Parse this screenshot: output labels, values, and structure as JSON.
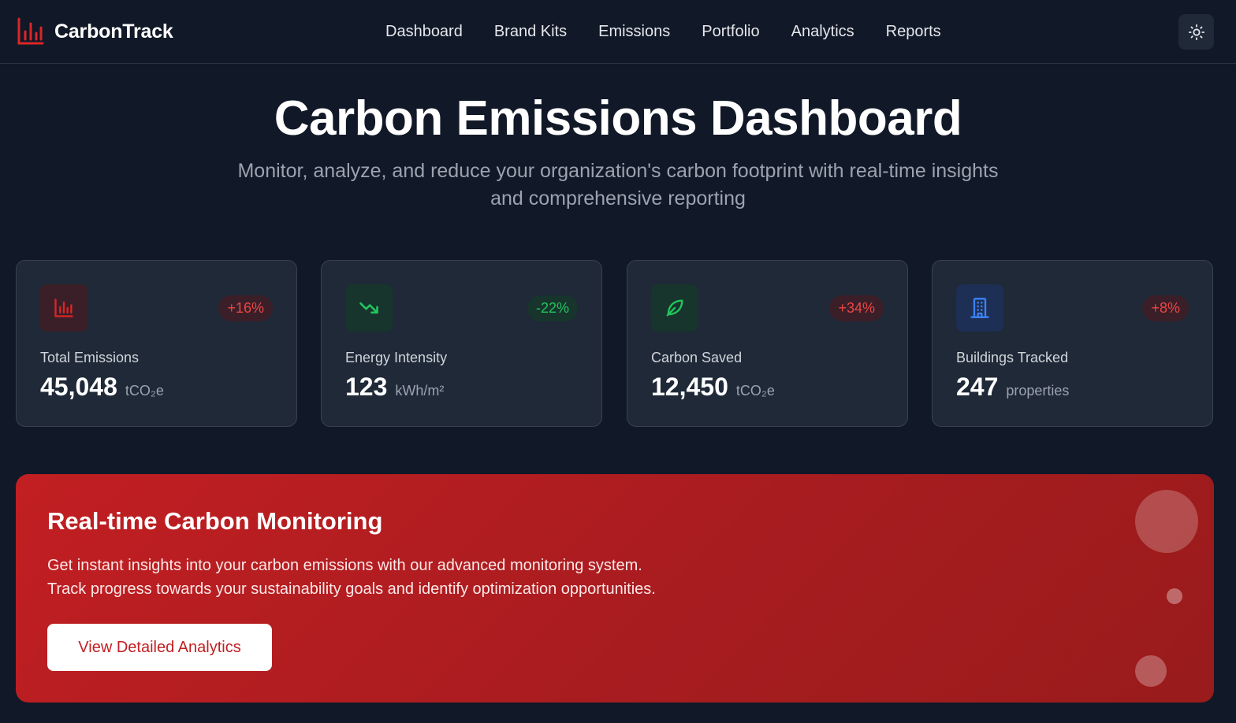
{
  "app": {
    "name": "CarbonTrack"
  },
  "nav": {
    "items": [
      {
        "label": "Dashboard"
      },
      {
        "label": "Brand Kits"
      },
      {
        "label": "Emissions"
      },
      {
        "label": "Portfolio"
      },
      {
        "label": "Analytics"
      },
      {
        "label": "Reports"
      }
    ]
  },
  "hero": {
    "title": "Carbon Emissions Dashboard",
    "subtitle": "Monitor, analyze, and reduce your organization's carbon footprint with real-time insights and comprehensive reporting"
  },
  "stats": [
    {
      "icon": "bar-chart-icon",
      "badge": "+16%",
      "badge_tone": "red",
      "label": "Total Emissions",
      "value": "45,048",
      "unit": "tCO₂e"
    },
    {
      "icon": "trending-down-icon",
      "badge": "-22%",
      "badge_tone": "green",
      "label": "Energy Intensity",
      "value": "123",
      "unit": "kWh/m²"
    },
    {
      "icon": "leaf-icon",
      "badge": "+34%",
      "badge_tone": "red",
      "label": "Carbon Saved",
      "value": "12,450",
      "unit": "tCO₂e"
    },
    {
      "icon": "building-icon",
      "badge": "+8%",
      "badge_tone": "red",
      "label": "Buildings Tracked",
      "value": "247",
      "unit": "properties"
    }
  ],
  "banner": {
    "title": "Real-time Carbon Monitoring",
    "text_line1": "Get instant insights into your carbon emissions with our advanced monitoring system.",
    "text_line2": "Track progress towards your sustainability goals and identify optimization opportunities.",
    "button_label": "View Detailed Analytics"
  },
  "colors": {
    "background": "#111827",
    "card": "#1f2937",
    "accent_red": "#dc2626",
    "positive_green": "#22c55e",
    "building_blue": "#3b82f6"
  },
  "icons": {
    "brand": "bar-chart-icon",
    "theme_toggle": "sun-icon"
  }
}
